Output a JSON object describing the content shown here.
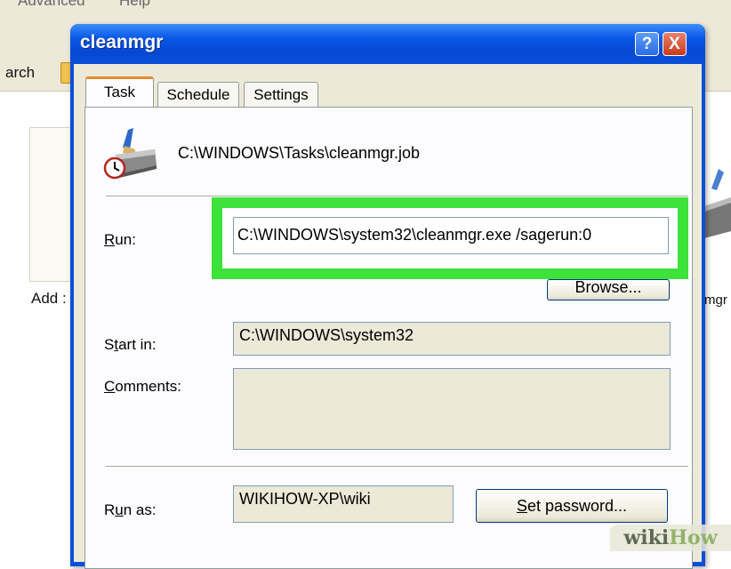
{
  "background_window": {
    "menu_items": [
      "Advanced",
      "Help"
    ],
    "search_label": "arch",
    "left_item_label": "Add :",
    "right_item_label": "mgr"
  },
  "dialog": {
    "title": "cleanmgr",
    "help_button": "?",
    "close_button": "X",
    "tabs": [
      {
        "label": "Task",
        "active": true
      },
      {
        "label": "Schedule",
        "active": false
      },
      {
        "label": "Settings",
        "active": false
      }
    ],
    "job_path": "C:\\WINDOWS\\Tasks\\cleanmgr.job",
    "run": {
      "label_key": "R",
      "label_rest": "un:",
      "value": "C:\\WINDOWS\\system32\\cleanmgr.exe /sagerun:0"
    },
    "browse_button": "Browse...",
    "start_in": {
      "label_pre": "S",
      "label_key": "t",
      "label_rest": "art in:",
      "value": "C:\\WINDOWS\\system32"
    },
    "comments": {
      "label_key": "C",
      "label_rest": "omments:",
      "value": ""
    },
    "run_as": {
      "label_pre": "R",
      "label_key": "u",
      "label_rest": "n as:",
      "value": "WIKIHOW-XP\\wiki"
    },
    "set_password_button": {
      "key": "S",
      "rest": "et password..."
    }
  },
  "highlight_color": "#3de33a",
  "watermark": {
    "part1": "wiki",
    "part2": "How"
  },
  "icons": [
    "broom-clock-icon",
    "help-icon",
    "close-icon",
    "folder-icon"
  ]
}
